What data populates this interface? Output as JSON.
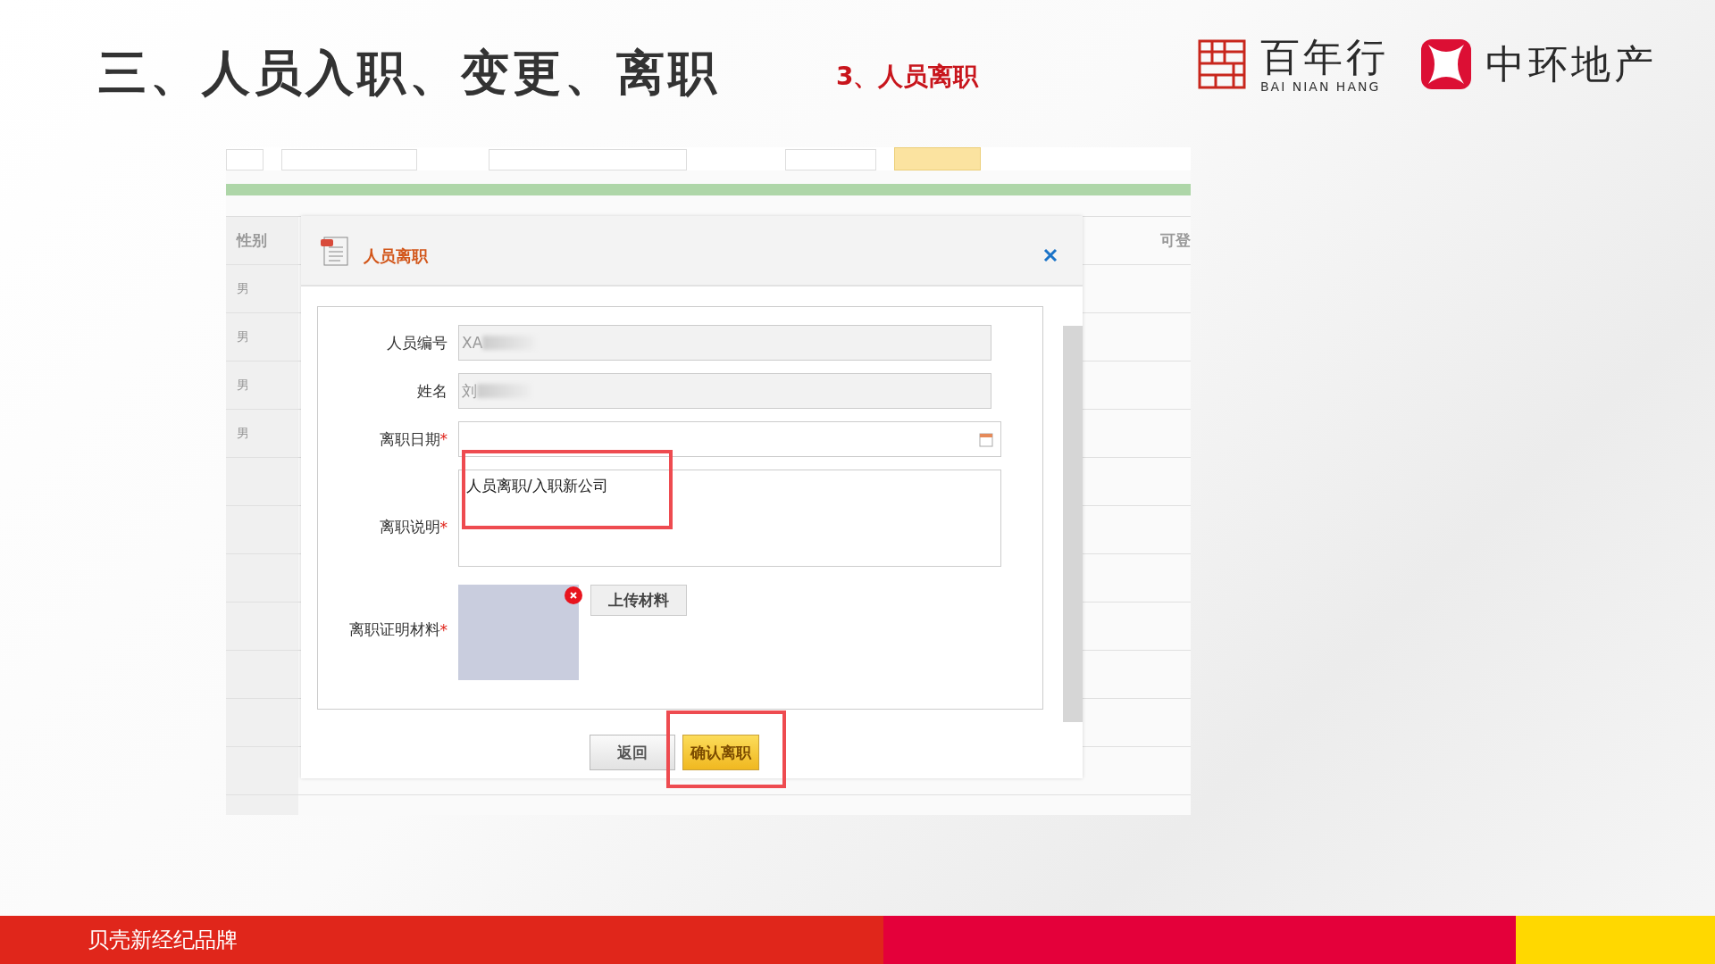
{
  "slide": {
    "title": "三、人员入职、变更、离职",
    "subtitle": "3、人员离职",
    "logos": [
      {
        "name": "百年行",
        "romanized": "BAI NIAN HANG"
      },
      {
        "name": "中环地产"
      }
    ],
    "footer": "贝壳新经纪品牌"
  },
  "app": {
    "table": {
      "columns": [
        "性别",
        "可登"
      ],
      "rows": [
        [
          "男",
          ""
        ],
        [
          "男",
          ""
        ],
        [
          "男",
          ""
        ],
        [
          "男",
          ""
        ],
        [
          "",
          ""
        ],
        [
          "",
          ""
        ],
        [
          "",
          ""
        ],
        [
          "",
          ""
        ],
        [
          "",
          ""
        ],
        [
          "",
          ""
        ],
        [
          "",
          ""
        ],
        [
          "",
          ""
        ]
      ]
    },
    "dialog": {
      "title": "人员离职",
      "fields": [
        {
          "kind": "text",
          "label": "人员编号",
          "value": "XA",
          "disabled": true,
          "redacted": true
        },
        {
          "kind": "text",
          "label": "姓名",
          "value": "刘",
          "disabled": true,
          "redacted": true
        },
        {
          "kind": "date",
          "label": "离职日期",
          "required_mark": "*",
          "disabled": false
        },
        {
          "kind": "textarea",
          "label": "离职说明",
          "required_mark": "*",
          "value": "人员离职/入职新公司",
          "disabled": false,
          "highlighted": true
        },
        {
          "kind": "upload",
          "label": "离职证明材料",
          "required_mark": "*",
          "button": "上传材料"
        }
      ],
      "buttons": [
        {
          "label": "返回",
          "primary": false,
          "highlighted": false
        },
        {
          "label": "确认离职",
          "primary": true,
          "highlighted": true
        }
      ]
    }
  }
}
